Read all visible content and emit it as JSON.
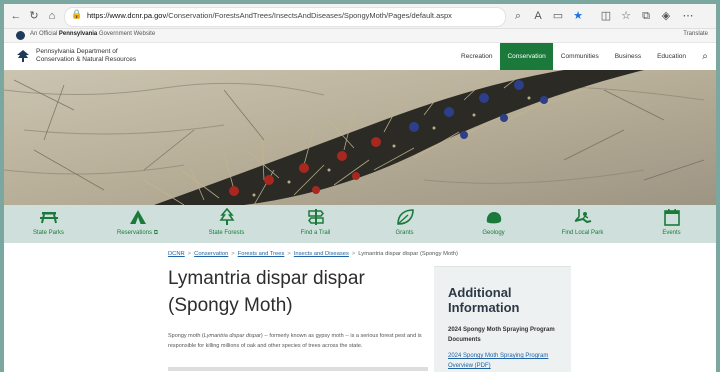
{
  "browser": {
    "url_host": "https://www.dcnr.pa.gov",
    "url_path": "/Conservation/ForestsAndTrees/InsectsAndDiseases/SpongyMoth/Pages/default.aspx"
  },
  "official_banner": {
    "prefix": "An Official ",
    "state": "Pennsylvania",
    "suffix": " Government Website",
    "translate": "Translate"
  },
  "site": {
    "logo_line1": "Pennsylvania Department of",
    "logo_line2": "Conservation & Natural Resources",
    "nav": [
      "Recreation",
      "Conservation",
      "Communities",
      "Business",
      "Education"
    ],
    "nav_active_index": 1
  },
  "quick_links": [
    {
      "label": "State Parks",
      "icon": "picnic-table-icon"
    },
    {
      "label": "Reservations",
      "icon": "tent-icon"
    },
    {
      "label": "State Forests",
      "icon": "tree-icon"
    },
    {
      "label": "Find a Trail",
      "icon": "trail-sign-icon"
    },
    {
      "label": "Grants",
      "icon": "leaf-icon"
    },
    {
      "label": "Geology",
      "icon": "rock-icon"
    },
    {
      "label": "Find Local Park",
      "icon": "swing-icon"
    },
    {
      "label": "Events",
      "icon": "calendar-icon"
    }
  ],
  "breadcrumb": [
    "DCNR",
    "Conservation",
    "Forests and Trees",
    "Insects and Diseases",
    "Lymantria dispar dispar (Spongy Moth)"
  ],
  "page": {
    "title_line1": "Lymantria dispar dispar",
    "title_line2": "(Spongy Moth)",
    "intro_a": "Spongy moth (",
    "intro_italic": "Lymantria dispar dispar",
    "intro_b": ") -- formerly known as gypsy moth -- is a serious forest pest and is responsible for killing millions of oak and other species of trees across the state."
  },
  "sidebar": {
    "title_line1": "Additional",
    "title_line2": "Information",
    "heading": "2024 Spongy Moth Spraying Program Documents",
    "link": "2024 Spongy Moth Spraying Program Overview (PDF)"
  },
  "colors": {
    "brand_green": "#1b7a3b",
    "quick_bar_bg": "#cfe0dc",
    "link_blue": "#1e62a3"
  }
}
